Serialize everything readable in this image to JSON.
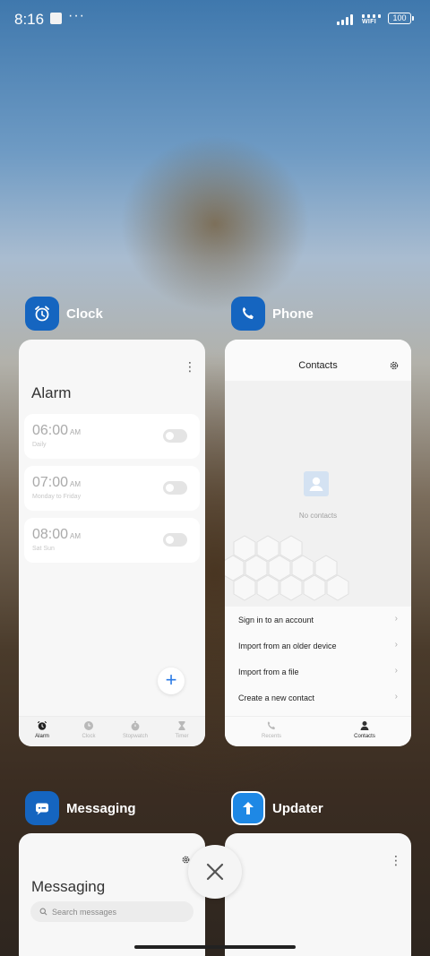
{
  "status_bar": {
    "time": "8:16",
    "more": "···",
    "network": "WIFI",
    "battery": "100"
  },
  "apps": {
    "clock": {
      "name": "Clock",
      "icon": "alarm-clock-icon",
      "color": "#1565c0",
      "screen_title": "Alarm",
      "alarms": [
        {
          "time": "06:00",
          "ampm": "AM",
          "repeat": "Daily"
        },
        {
          "time": "07:00",
          "ampm": "AM",
          "repeat": "Monday to Friday"
        },
        {
          "time": "08:00",
          "ampm": "AM",
          "repeat": "Sat Sun"
        }
      ],
      "tabs": [
        "Alarm",
        "Clock",
        "Stopwatch",
        "Timer"
      ]
    },
    "phone": {
      "name": "Phone",
      "icon": "phone-icon",
      "color": "#1565c0",
      "screen_title": "Contacts",
      "empty_text": "No contacts",
      "menu": [
        "Sign in to an account",
        "Import from an older device",
        "Import from a file",
        "Create a new contact"
      ],
      "tabs": [
        "Recents",
        "Contacts"
      ]
    },
    "messaging": {
      "name": "Messaging",
      "icon": "message-bubble-icon",
      "color": "#1565c0",
      "screen_title": "Messaging",
      "search_placeholder": "Search messages"
    },
    "updater": {
      "name": "Updater",
      "icon": "up-arrow-icon",
      "color": "#1e88e5"
    }
  },
  "close_button_icon": "close-icon"
}
